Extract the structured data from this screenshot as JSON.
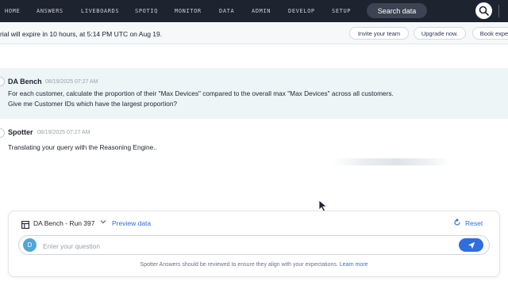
{
  "nav": {
    "items": [
      "HOME",
      "ANSWERS",
      "LIVEBOARDS",
      "SPOTIQ",
      "MONITOR",
      "DATA",
      "ADMIN",
      "DEVELOP",
      "SETUP"
    ],
    "search_label": "Search data"
  },
  "trial": {
    "text": "rial will expire in 10 hours, at 5:14 PM UTC on Aug 19.",
    "invite_label": "Invite your team",
    "upgrade_label": "Upgrade now.",
    "book_label": "Book expe"
  },
  "conversation": {
    "user_message": {
      "author": "DA Bench",
      "timestamp": "08/19/2025 07:27 AM",
      "text": "For each customer, calculate the proportion of their \"Max Devices\" compared to the overall max \"Max Devices\" across all customers. Give me Customer IDs which have the largest proportion?"
    },
    "bot_message": {
      "author": "Spotter",
      "timestamp": "08/19/2025 07:27 AM",
      "text": "Translating your query with the Reasoning Engine.."
    }
  },
  "composer": {
    "source_label": "DA Bench - Run 397",
    "preview_label": "Preview data",
    "reset_label": "Reset",
    "avatar_letter": "D",
    "placeholder": "Enter your question",
    "disclaimer": "Spotter Answers should be reviewed to ensure they align with your expectations.",
    "learn_more": "Learn more"
  },
  "colors": {
    "nav_bg": "#1d232f",
    "accent": "#2f6de1",
    "message_highlight": "#edf5f7",
    "avatar": "#4fa7d6"
  },
  "icons": [
    "search-icon",
    "table-icon",
    "chevron-down-icon",
    "reset-icon",
    "send-icon",
    "cursor-icon"
  ]
}
